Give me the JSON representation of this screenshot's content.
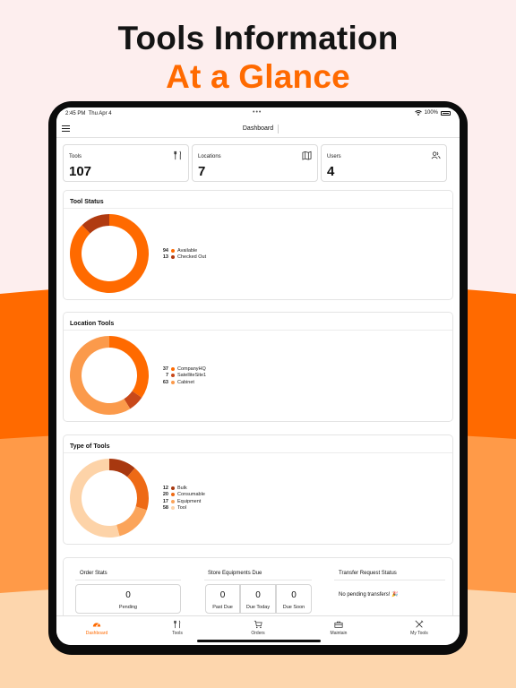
{
  "headline": {
    "line1": "Tools Information",
    "line2": "At a Glance"
  },
  "colors": {
    "accent": "#ff6a00",
    "dark_orange": "#b03a10",
    "mid_orange": "#f0721c",
    "light_orange": "#fb9a4b",
    "pale_orange": "#fdd3a8"
  },
  "statusbar": {
    "time": "2:45 PM",
    "date": "Thu Apr 4",
    "battery": "100%"
  },
  "navbar": {
    "title": "Dashboard",
    "menu_icon": "hamburger-menu-icon"
  },
  "summary": [
    {
      "label": "Tools",
      "value": "107",
      "icon": "tools-icon"
    },
    {
      "label": "Locations",
      "value": "7",
      "icon": "map-icon"
    },
    {
      "label": "Users",
      "value": "4",
      "icon": "users-icon"
    }
  ],
  "panels": {
    "tool_status": {
      "title": "Tool Status"
    },
    "location_tools": {
      "title": "Location Tools"
    },
    "type_of_tools": {
      "title": "Type of Tools"
    }
  },
  "chart_data": [
    {
      "type": "pie",
      "title": "Tool Status",
      "categories": [
        "Available",
        "Checked Out"
      ],
      "values": [
        94,
        13
      ],
      "colors": [
        "#ff6a00",
        "#b03a10"
      ]
    },
    {
      "type": "pie",
      "title": "Location Tools",
      "categories": [
        "CompanyHQ",
        "SatelliteSite1",
        "Cabinet"
      ],
      "values": [
        37,
        7,
        63
      ],
      "colors": [
        "#ff6a00",
        "#c8481a",
        "#fb9a4b"
      ]
    },
    {
      "type": "pie",
      "title": "Type of Tools",
      "categories": [
        "Bulk",
        "Consumable",
        "Equipment",
        "Tool"
      ],
      "values": [
        12,
        20,
        17,
        58
      ],
      "colors": [
        "#a8380f",
        "#ee6a15",
        "#fba45a",
        "#fdd3a8"
      ]
    }
  ],
  "stats": {
    "order_stats": {
      "title": "Order Stats",
      "pending_value": "0",
      "pending_label": "Pending"
    },
    "store_equipments_due": {
      "title": "Store Equipments Due",
      "items": [
        {
          "value": "0",
          "label": "Past Due"
        },
        {
          "value": "0",
          "label": "Due Today"
        },
        {
          "value": "0",
          "label": "Due Soon"
        }
      ]
    },
    "transfer_request_status": {
      "title": "Transfer Request Status",
      "message": "No pending transfers! 🎉"
    }
  },
  "tabs": [
    {
      "label": "Dashboard",
      "icon": "dashboard-icon",
      "active": true
    },
    {
      "label": "Tools",
      "icon": "tools-icon",
      "active": false
    },
    {
      "label": "Orders",
      "icon": "cart-icon",
      "active": false
    },
    {
      "label": "Maintain",
      "icon": "toolbox-icon",
      "active": false
    },
    {
      "label": "My Tools",
      "icon": "wrench-screwdriver-icon",
      "active": false
    }
  ]
}
